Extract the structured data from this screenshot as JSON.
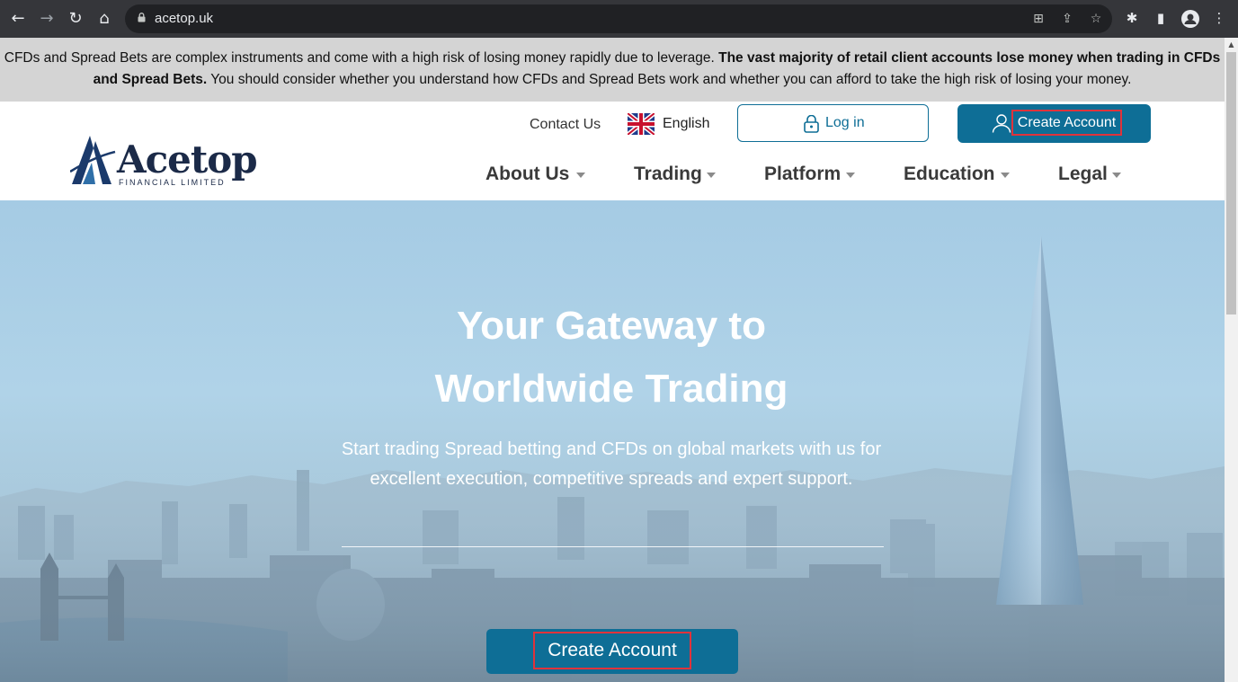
{
  "browser": {
    "url": "acetop.uk",
    "back_icon": "arrow-left-icon",
    "forward_icon": "arrow-right-icon",
    "reload_icon": "reload-icon",
    "home_icon": "home-icon"
  },
  "warning": {
    "text_plain_1": "CFDs and Spread Bets are complex instruments and come with a high risk of losing money rapidly due to leverage. ",
    "text_bold": "The vast majority of retail client accounts lose money when trading in CFDs and Spread Bets.",
    "text_plain_2": " You should consider whether you understand how CFDs and Spread Bets work and whether you can afford to take the high risk of losing your money."
  },
  "header": {
    "logo_name": "Acetop",
    "logo_sub": "FINANCIAL LIMITED",
    "contact": "Contact Us",
    "language": "English",
    "login": "Log in",
    "create_account": "Create Account"
  },
  "menu": [
    {
      "label": "About Us"
    },
    {
      "label": "Trading"
    },
    {
      "label": "Platform"
    },
    {
      "label": "Education"
    },
    {
      "label": "Legal"
    }
  ],
  "hero": {
    "title_line1": "Your Gateway to",
    "title_line2": "Worldwide Trading",
    "subtitle": "Start trading Spread betting and CFDs on global markets with us for excellent execution, competitive spreads and expert support.",
    "cta": "Create Account"
  },
  "colors": {
    "brand": "#0e6e96",
    "highlight": "#e0333b",
    "banner": "#d4d4d4"
  }
}
